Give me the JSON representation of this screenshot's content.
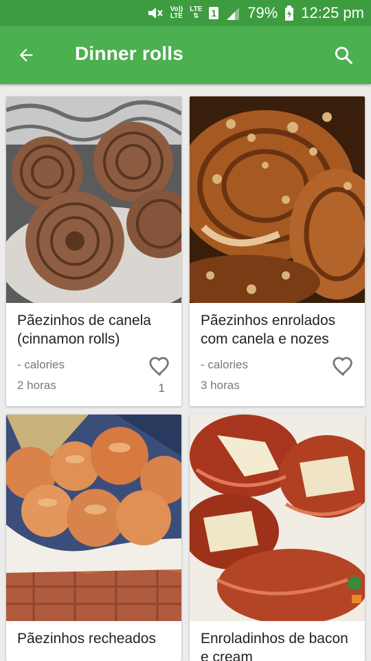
{
  "status_bar": {
    "volte_top": "Vo))",
    "volte_bottom": "LTE",
    "lte_label": "LTE",
    "sim_slot": "1",
    "battery": "79%",
    "time": "12:25 pm"
  },
  "app_bar": {
    "title": "Dinner rolls",
    "back_icon": "arrow-back-icon",
    "search_icon": "search-icon"
  },
  "recipes": [
    {
      "title": "Pãezinhos de canela (cinnamon rolls)",
      "calories": "- calories",
      "time": "2 horas",
      "favorites": "1"
    },
    {
      "title": "Pãezinhos enrolados com canela e nozes",
      "calories": "- calories",
      "time": "3 horas",
      "favorites": ""
    },
    {
      "title": "Pãezinhos recheados",
      "calories": "",
      "time": "",
      "favorites": ""
    },
    {
      "title": "Enroladinhos de bacon e cream",
      "calories": "",
      "time": "",
      "favorites": ""
    }
  ],
  "colors": {
    "status_bar": "#3d9c40",
    "app_bar": "#4caf50",
    "background": "#ececec"
  }
}
